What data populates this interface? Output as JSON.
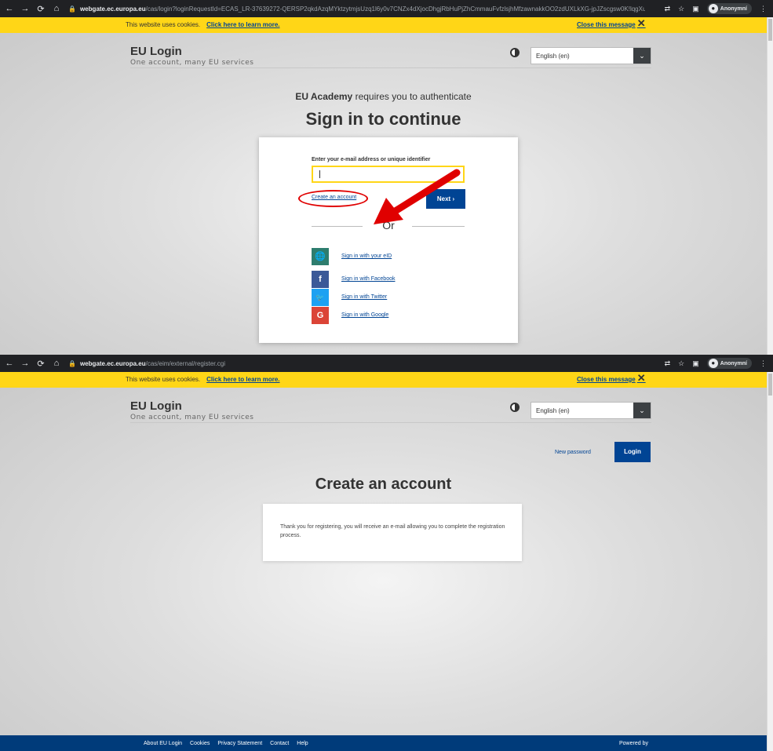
{
  "screens": [
    {
      "browser": {
        "url_host": "webgate.ec.europa.eu",
        "url_path": "/cas/login?loginRequestId=ECAS_LR-37639272-QERSP2qkdAzqMYktzytmjsUzq1l6y0v7CNZx4dXjocDhgjRbHuPjZhCmmauFvfzlsjhMfzawnakkOO2zdUXLkXG-jpJZscgsw0K!lqgXuxzly...",
        "profile_label": "Anonymní"
      },
      "cookie": {
        "message": "This website uses cookies.",
        "learn_more": "Click here to learn more.",
        "close": "Close this message"
      },
      "header": {
        "title": "EU Login",
        "subtitle": "One account, many EU services",
        "language": "English (en)"
      },
      "auth": {
        "requester": "EU Academy",
        "requires_text": "requires you to authenticate",
        "heading": "Sign in to continue",
        "email_label": "Enter your e-mail address or unique identifier",
        "create_account": "Create an account",
        "next": "Next ›",
        "or": "Or",
        "providers": [
          {
            "label": "Sign in with your eID",
            "glyph": "🌐",
            "color": "#2e7d6e"
          },
          {
            "label": "Sign in with Facebook",
            "glyph": "f",
            "color": "#3b5998"
          },
          {
            "label": "Sign in with Twitter",
            "glyph": "🐦",
            "color": "#1da1f2"
          },
          {
            "label": "Sign in with Google",
            "glyph": "G",
            "color": "#db4437"
          }
        ]
      }
    },
    {
      "browser": {
        "url_host": "webgate.ec.europa.eu",
        "url_path": "/cas/eim/external/register.cgi",
        "profile_label": "Anonymní"
      },
      "cookie": {
        "message": "This website uses cookies.",
        "learn_more": "Click here to learn more.",
        "close": "Close this message"
      },
      "header": {
        "title": "EU Login",
        "subtitle": "One account, many EU services",
        "language": "English (en)"
      },
      "top_actions": {
        "new_password": "New password",
        "login": "Login"
      },
      "register": {
        "heading": "Create an account",
        "message": "Thank you for registering, you will receive an e-mail allowing you to complete the registration process."
      },
      "footer": {
        "links": [
          "About EU Login",
          "Cookies",
          "Privacy Statement",
          "Contact",
          "Help"
        ],
        "powered": "Powered by"
      }
    }
  ],
  "colors": {
    "accent_yellow": "#ffd617",
    "eu_blue": "#004494",
    "footer_blue": "#003b7a",
    "annotation_red": "#e00000"
  }
}
